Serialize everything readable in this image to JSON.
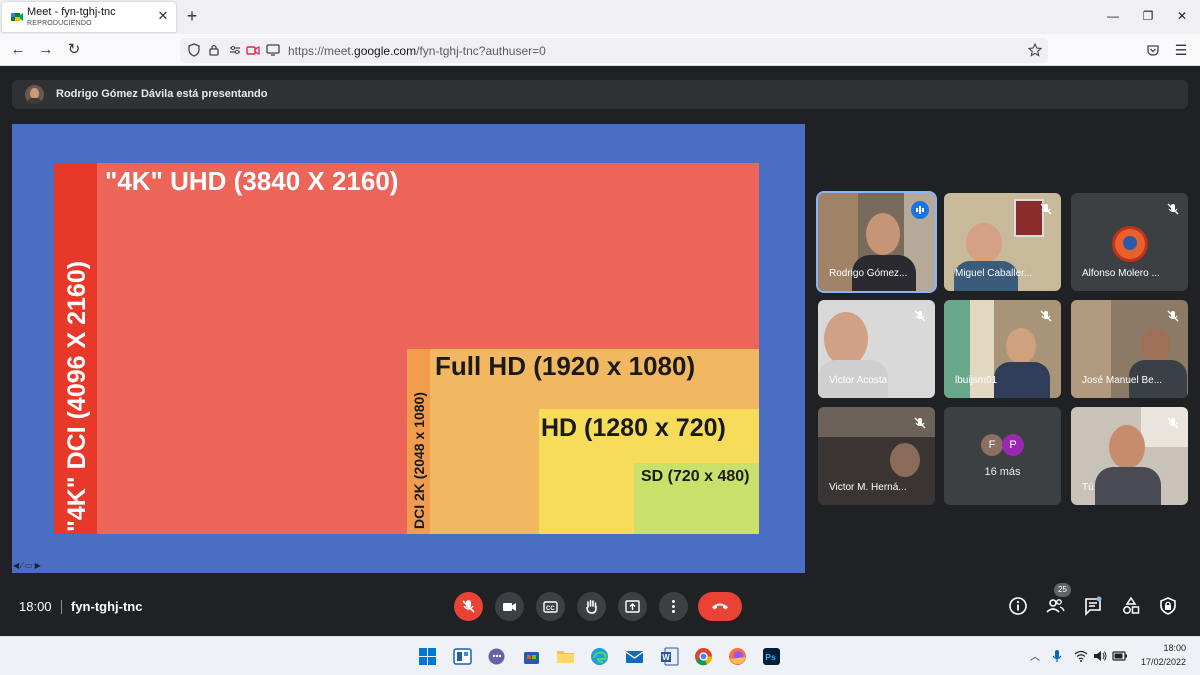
{
  "browser": {
    "tab_title": "Meet - fyn-tghj-tnc",
    "tab_subtitle": "REPRODUCIENDO",
    "url_prefix": "https://meet.",
    "url_domain": "google.com",
    "url_path": "/fyn-tghj-tnc?authuser=0"
  },
  "presenting": {
    "text": "Rodrigo Gómez Dávila está presentando"
  },
  "slide": {
    "uhd_label": "\"4K\" UHD (3840 X 2160)",
    "dci4k_label": "\"4K\" DCI (4096 X 2160)",
    "fullhd_label": "Full HD (1920 x 1080)",
    "dci2k_label": "DCI 2K (2048 x 1080)",
    "hd_label": "HD (1280 x 720)",
    "sd_label": "SD (720 x 480)",
    "colors": {
      "uhd": "#ed6558",
      "dci4k": "#e8382a",
      "dci2k": "#f19d4d",
      "fullhd": "#f2b761",
      "hd": "#f6dc5a",
      "sd": "#cbe06b",
      "background": "#4a6ec1"
    }
  },
  "participants": [
    {
      "name": "Rodrigo Gómez Dávila",
      "display": "Rodrigo Gómez...",
      "status": "speaking"
    },
    {
      "name": "Miguel Caballero",
      "display": "Miguel Caballer...",
      "status": "muted"
    },
    {
      "name": "Alfonso Molero",
      "display": "Alfonso Molero ...",
      "status": "muted"
    },
    {
      "name": "Victor Acosta",
      "display": "Victor Acosta",
      "status": "muted"
    },
    {
      "name": "lbuijsm01",
      "display": "lbuijsm01",
      "status": "muted"
    },
    {
      "name": "José Manuel Be",
      "display": "José Manuel Be...",
      "status": "muted"
    },
    {
      "name": "Victor M. Hernández",
      "display": "Victor M. Herná...",
      "status": "muted"
    },
    {
      "name": "Tú",
      "display": "Tú",
      "status": "muted"
    }
  ],
  "more_tile": {
    "avatar1": "F",
    "avatar2": "P",
    "label": "16 más"
  },
  "bottom_bar": {
    "time": "18:00",
    "meeting_code": "fyn-tghj-tnc",
    "participant_count": "25"
  },
  "taskbar": {
    "time": "18:00",
    "date": "17/02/2022"
  }
}
